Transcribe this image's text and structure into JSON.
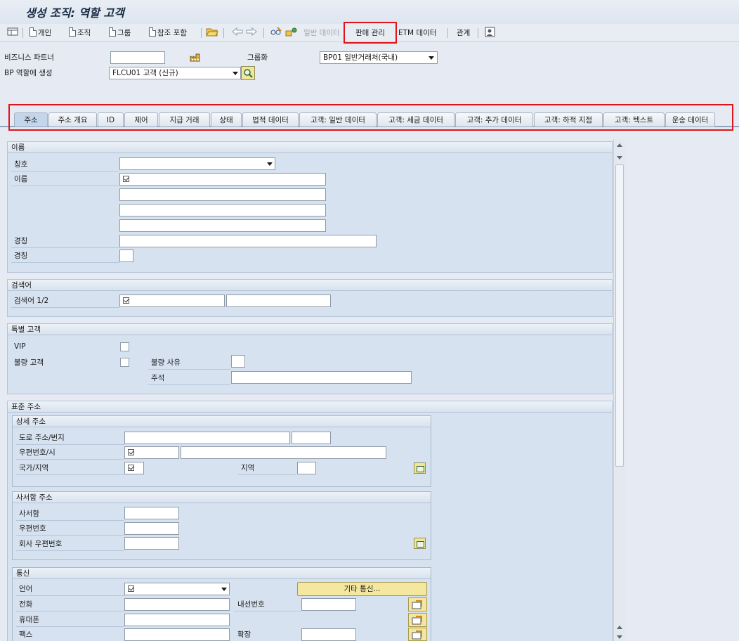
{
  "window": {
    "title": "생성 조직: 역할 고객"
  },
  "toolbar": {
    "person": "개인",
    "org": "조직",
    "group": "그룹",
    "ref": "참조 포함",
    "general_data": "일반 데이터",
    "sales": "판매 관리",
    "etm": "ETM 데이터",
    "relations": "관계"
  },
  "header": {
    "bp_label": "비즈니스 파트너",
    "bp_value": "",
    "grouping_label": "그룹화",
    "grouping_value": "BP01 일반거래처(국내)",
    "role_label": "BP 역할에 생성",
    "role_value": "FLCU01 고객 (신규)"
  },
  "tabs": [
    "주소",
    "주소 개요",
    "ID",
    "제어",
    "지급 거래",
    "상태",
    "법적 데이터",
    "고객: 일반 데이터",
    "고객: 세금 데이터",
    "고객: 추가 데이터",
    "고객: 하적 지점",
    "고객: 텍스트",
    "운송 데이터"
  ],
  "name_section": {
    "title": "이름",
    "salutation": "칭호",
    "name": "이름",
    "title1": "경칭",
    "title2": "경칭"
  },
  "search_section": {
    "title": "검색어",
    "term": "검색어 1/2"
  },
  "special_section": {
    "title": "특별 고객",
    "vip": "VIP",
    "bad_customer": "불량 고객",
    "bad_reason": "불량 사유",
    "comment": "주석"
  },
  "std_address": {
    "title": "표준 주소",
    "detail": {
      "title": "상세 주소",
      "street": "도로 주소/번지",
      "postal_city": "우편번호/시",
      "country": "국가/지역",
      "region": "지역"
    },
    "pobox": {
      "title": "사서함 주소",
      "pobox": "사서함",
      "postal": "우편번호",
      "company_postal": "회사 우편번호"
    },
    "comm": {
      "title": "통신",
      "language": "언어",
      "other_comm": "기타 통신...",
      "phone": "전화",
      "extension": "내선번호",
      "mobile": "휴대폰",
      "fax": "팩스",
      "fax_ext": "확장"
    }
  }
}
